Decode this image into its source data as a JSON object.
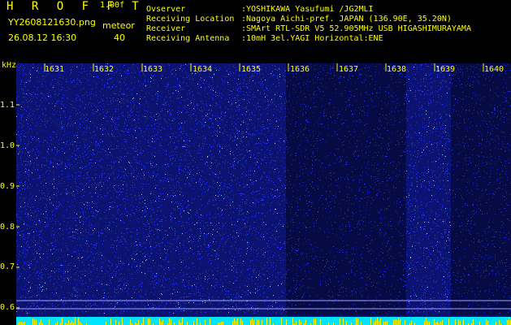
{
  "header": {
    "brand": "H R O F F T",
    "version": "1.00f",
    "filename": "YY2608121630.png",
    "meteor_label": "meteor",
    "datetime": "26.08.12 16:30",
    "meteor_count": "40",
    "meta": [
      {
        "label": "Ovserver",
        "value": ":YOSHIKAWA Yasufumi /JG2MLI"
      },
      {
        "label": "Receiving Location",
        "value": ":Nagoya Aichi-pref. JAPAN (136.90E, 35.20N)"
      },
      {
        "label": "Receiver",
        "value": ":SMArt RTL-SDR V5 52.905MHz USB HIGASHIMURAYAMA"
      },
      {
        "label": "Receiving Antenna",
        "value": ":10mH 3el.YAGI Horizontal:ENE"
      }
    ]
  },
  "axes": {
    "y_unit": "kHz",
    "y_ticks": [
      "1.1",
      "1.0",
      "0.9",
      "0.8",
      "0.7",
      "0.6"
    ],
    "x_ticks": [
      "1631",
      "1632",
      "1633",
      "1634",
      "1635",
      "1636",
      "1637",
      "1638",
      "1639",
      "1640"
    ]
  },
  "colors": {
    "background": "#000000",
    "text": "#ffff00",
    "noise_bright": "#2a3cff",
    "noise_dark": "#101a80",
    "baseline": "#00e5ff"
  }
}
